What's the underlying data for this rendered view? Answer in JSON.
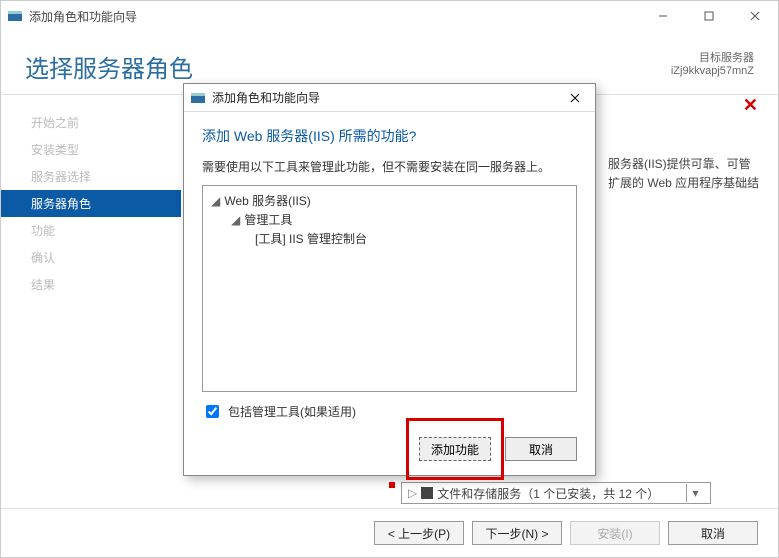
{
  "outer": {
    "title": "添加角色和功能向导",
    "heading": "选择服务器角色",
    "destination_label": "目标服务器",
    "destination_value": "iZj9kkvapj57mnZ",
    "sidebar_steps": [
      "开始之前",
      "安装类型",
      "服务器选择",
      "服务器角色",
      "功能",
      "确认",
      "结果"
    ],
    "sidebar_active_index": 3,
    "right_desc_line1": "服务器(IIS)提供可靠、可管",
    "right_desc_line2": "扩展的 Web 应用程序基础结",
    "tree_selected_row": "文件和存储服务（1 个已安装，共 12 个）",
    "buttons": {
      "prev": "< 上一步(P)",
      "next": "下一步(N) >",
      "install": "安装(I)",
      "cancel": "取消"
    }
  },
  "modal": {
    "title": "添加角色和功能向导",
    "heading": "添加 Web 服务器(IIS) 所需的功能?",
    "desc": "需要使用以下工具来管理此功能，但不需要安装在同一服务器上。",
    "tree": {
      "lvl0": "Web 服务器(IIS)",
      "lvl1": "管理工具",
      "lvl2": "[工具] IIS 管理控制台"
    },
    "include_label": "包括管理工具(如果适用)",
    "include_checked": true,
    "buttons": {
      "add": "添加功能",
      "cancel": "取消"
    }
  }
}
